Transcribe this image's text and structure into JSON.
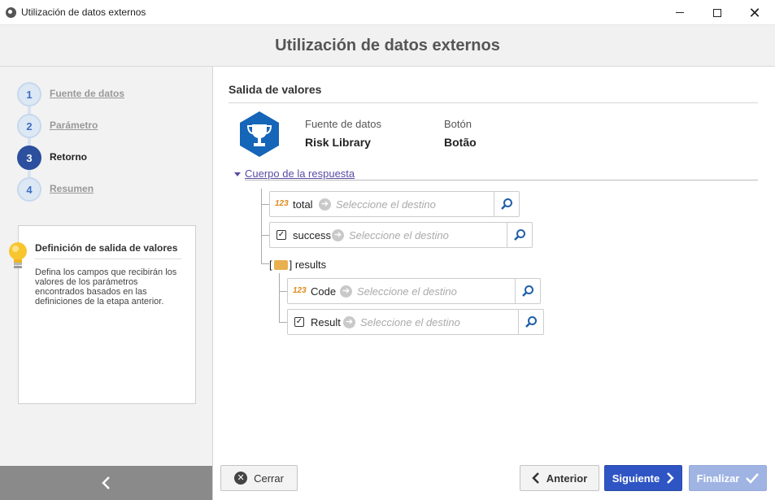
{
  "window": {
    "title": "Utilización de datos externos"
  },
  "header": {
    "title": "Utilización de datos externos"
  },
  "steps": [
    {
      "num": "1",
      "label": "Fuente de datos"
    },
    {
      "num": "2",
      "label": "Parámetro"
    },
    {
      "num": "3",
      "label": "Retorno"
    },
    {
      "num": "4",
      "label": "Resumen"
    }
  ],
  "tip": {
    "title": "Definición de salida de valores",
    "text": "Defina los campos que recibirán los valores de los parámetros encontrados basados en las definiciones de la etapa anterior."
  },
  "main": {
    "section_title": "Salida de valores",
    "meta": {
      "source_label": "Fuente de datos",
      "source_value": "Risk Library",
      "button_label": "Botón",
      "button_value": "Botão"
    },
    "response_head": "Cuerpo de la respuesta",
    "destination_placeholder": "Seleccione el destino",
    "fields": {
      "total": "total",
      "success": "success",
      "results": "results",
      "code": "Code",
      "result": "Result"
    },
    "type_num_label": "123"
  },
  "footer": {
    "close": "Cerrar",
    "previous": "Anterior",
    "next": "Siguiente",
    "finish": "Finalizar"
  },
  "colors": {
    "primary": "#2f55c4",
    "disabled_primary": "#9fb4e3",
    "step_active": "#2c4f9e",
    "link": "#5a4ca6",
    "trophy": "#1565b8"
  }
}
